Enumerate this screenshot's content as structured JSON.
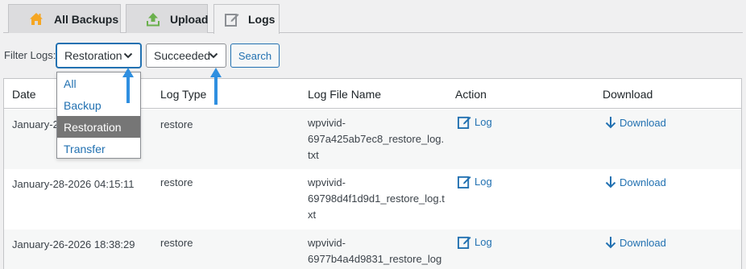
{
  "tabs": [
    {
      "label": "All Backups",
      "icon": "home-icon"
    },
    {
      "label": "Upload",
      "icon": "upload-icon"
    },
    {
      "label": "Logs",
      "icon": "edit-icon"
    }
  ],
  "filter": {
    "label": "Filter Logs:",
    "type_select": "Restoration",
    "status_select": "Succeeded",
    "search_button": "Search",
    "dropdown_options": [
      "All",
      "Backup",
      "Restoration",
      "Transfer"
    ],
    "dropdown_selected": "Restoration"
  },
  "table": {
    "headers": [
      "Date",
      "Log Type",
      "Log File Name",
      "Action",
      "Download"
    ],
    "rows": [
      {
        "date": "January-2",
        "type": "restore",
        "fname": "wpvivid-697a425ab7ec8_restore_log.txt",
        "action": "Log",
        "download": "Download"
      },
      {
        "date": "January-28-2026 04:15:11",
        "type": "restore",
        "fname": "wpvivid-69798d4f1d9d1_restore_log.txt",
        "action": "Log",
        "download": "Download"
      },
      {
        "date": "January-26-2026 18:38:29",
        "type": "restore",
        "fname": "wpvivid-6977b4a4d9831_restore_log",
        "action": "Log",
        "download": "Download"
      }
    ]
  },
  "colors": {
    "accent": "#2271b1",
    "highlight_arrow": "#2f8fe0",
    "selected_option": "#767676"
  }
}
